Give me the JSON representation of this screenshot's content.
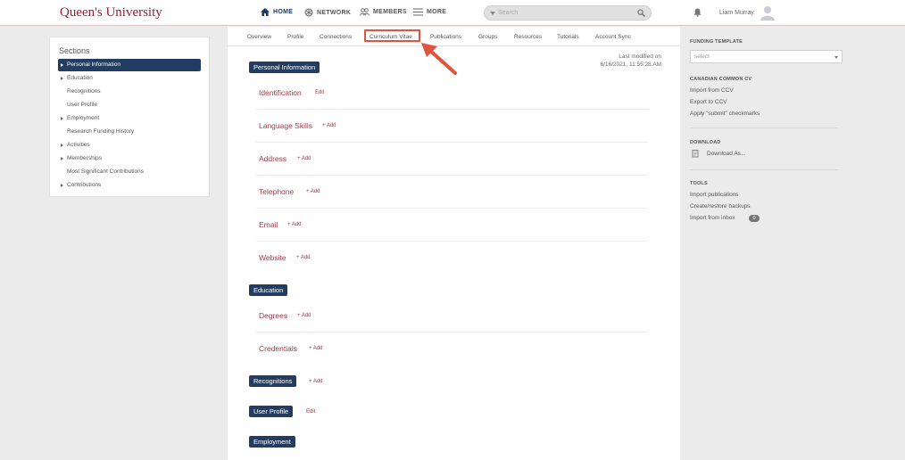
{
  "header": {
    "logo": "Queen's University",
    "nav": [
      {
        "label": "HOME",
        "icon": "home-icon"
      },
      {
        "label": "NETWORK",
        "icon": "network-icon"
      },
      {
        "label": "MEMBERS",
        "icon": "members-icon"
      },
      {
        "label": "MORE",
        "icon": "menu-icon"
      }
    ],
    "search_placeholder": "Search",
    "user_name": "Liam Murray"
  },
  "sidebar": {
    "title": "Sections",
    "items": [
      {
        "label": "Personal Information",
        "expandable": true,
        "active": true
      },
      {
        "label": "Education",
        "expandable": true
      },
      {
        "label": "Recognitions",
        "expandable": false
      },
      {
        "label": "User Profile",
        "expandable": false
      },
      {
        "label": "Employment",
        "expandable": true
      },
      {
        "label": "Research Funding History",
        "expandable": false
      },
      {
        "label": "Activities",
        "expandable": true
      },
      {
        "label": "Memberships",
        "expandable": true
      },
      {
        "label": "Most Significant Contributions",
        "expandable": false
      },
      {
        "label": "Contributions",
        "expandable": true
      }
    ]
  },
  "tabs": [
    "Overview",
    "Profile",
    "Connections",
    "Curriculum Vitae",
    "Publications",
    "Groups",
    "Resources",
    "Tutorials",
    "Account Sync"
  ],
  "selected_tab": "Curriculum Vitae",
  "last_modified": {
    "label": "Last modified on",
    "value": "6/16/2021, 11:55:28 AM"
  },
  "cv": {
    "personal_information": {
      "header": "Personal Information",
      "fields": [
        {
          "label": "Identification",
          "action": "Edit"
        },
        {
          "label": "Language Skills",
          "action": "+ Add"
        },
        {
          "label": "Address",
          "action": "+ Add"
        },
        {
          "label": "Telephone",
          "action": "+ Add"
        },
        {
          "label": "Email",
          "action": "+ Add"
        },
        {
          "label": "Website",
          "action": "+ Add"
        }
      ]
    },
    "education": {
      "header": "Education",
      "fields": [
        {
          "label": "Degrees",
          "action": "+ Add"
        },
        {
          "label": "Credentials",
          "action": "+ Add"
        }
      ]
    },
    "recognitions": {
      "header": "Recognitions",
      "action": "+ Add"
    },
    "user_profile": {
      "header": "User Profile",
      "action": "Edit"
    },
    "employment": {
      "header": "Employment"
    }
  },
  "right_panel": {
    "funding_template": {
      "heading": "FUNDING TEMPLATE",
      "select_value": "select"
    },
    "canadian_ccv": {
      "heading": "CANADIAN COMMON CV",
      "links": [
        "Import from CCV",
        "Export to CCV",
        "Apply \"submit\" checkmarks"
      ]
    },
    "download": {
      "heading": "DOWNLOAD",
      "link": "Download As..."
    },
    "tools": {
      "heading": "TOOLS",
      "links": [
        "Import publications",
        "Create/restore backups",
        "Import from inbox"
      ],
      "inbox_count": "0"
    }
  },
  "colors": {
    "brand": "#9e1b32",
    "navy": "#223c62",
    "link_red": "#a33a48",
    "highlight": "#e0533e"
  }
}
